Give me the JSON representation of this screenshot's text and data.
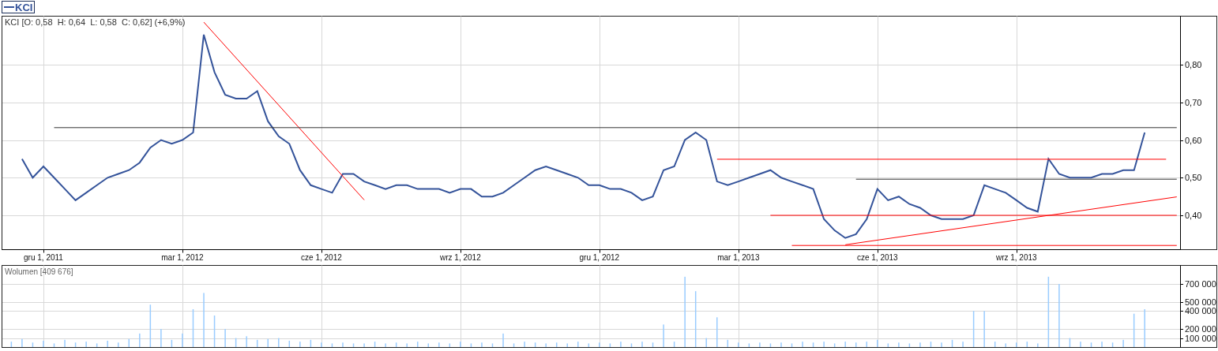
{
  "price_panel": {
    "header": "KCI [O: 0,58  H: 0,64  L: 0,58  C: 0,62] (+6,9%)",
    "chart_data": {
      "type": "line",
      "grid": true,
      "ylim": [
        0.31,
        0.93
      ],
      "categories": [
        null,
        null,
        null,
        "gru 1, 2011",
        null,
        null,
        null,
        null,
        null,
        null,
        null,
        null,
        null,
        null,
        null,
        null,
        "mar 1, 2012",
        null,
        null,
        null,
        null,
        null,
        null,
        null,
        null,
        null,
        null,
        null,
        null,
        "cze 1, 2012",
        null,
        null,
        null,
        null,
        null,
        null,
        null,
        null,
        null,
        null,
        null,
        null,
        "wrz 1, 2012",
        null,
        null,
        null,
        null,
        null,
        null,
        null,
        null,
        null,
        null,
        null,
        null,
        "gru 1, 2012",
        null,
        null,
        null,
        null,
        null,
        null,
        null,
        null,
        null,
        null,
        null,
        null,
        "mar 1, 2013",
        null,
        null,
        null,
        null,
        null,
        null,
        null,
        null,
        null,
        null,
        null,
        null,
        "cze 1, 2013",
        null,
        null,
        null,
        null,
        null,
        null,
        null,
        null,
        null,
        null,
        null,
        null,
        "wrz 1, 2013",
        null,
        null,
        null,
        null,
        null,
        null,
        null,
        null,
        null,
        null,
        null,
        null,
        null,
        null,
        null
      ],
      "yticks": [
        {
          "value": 0.4,
          "label": "0,40"
        },
        {
          "value": 0.5,
          "label": "0,50"
        },
        {
          "value": 0.6,
          "label": "0,60"
        },
        {
          "value": 0.7,
          "label": "0,70"
        },
        {
          "value": 0.8,
          "label": "0,80"
        }
      ],
      "series": [
        {
          "name": "KCI",
          "color": "#34539a",
          "values": [
            null,
            0.55,
            0.5,
            0.53,
            0.5,
            0.47,
            0.44,
            0.46,
            0.48,
            0.5,
            0.51,
            0.52,
            0.54,
            0.58,
            0.6,
            0.59,
            0.6,
            0.62,
            0.88,
            0.78,
            0.72,
            0.71,
            0.71,
            0.73,
            0.65,
            0.61,
            0.59,
            0.52,
            0.48,
            0.47,
            0.46,
            0.51,
            0.51,
            0.49,
            0.48,
            0.47,
            0.48,
            0.48,
            0.47,
            0.47,
            0.47,
            0.46,
            0.47,
            0.47,
            0.45,
            0.45,
            0.46,
            0.48,
            0.5,
            0.52,
            0.53,
            0.52,
            0.51,
            0.5,
            0.48,
            0.48,
            0.47,
            0.47,
            0.46,
            0.44,
            0.45,
            0.52,
            0.53,
            0.6,
            0.62,
            0.6,
            0.49,
            0.48,
            0.49,
            0.5,
            0.51,
            0.52,
            0.5,
            0.49,
            0.48,
            0.47,
            0.39,
            0.36,
            0.34,
            0.35,
            0.39,
            0.47,
            0.44,
            0.45,
            0.43,
            0.42,
            0.4,
            0.39,
            0.39,
            0.39,
            0.4,
            0.48,
            0.47,
            0.46,
            0.44,
            0.42,
            0.41,
            0.55,
            0.51,
            0.5,
            0.5,
            0.5,
            0.51,
            0.51,
            0.52,
            0.52,
            0.62,
            null,
            null,
            null
          ]
        },
        {
          "color": "#ff0000",
          "values": [
            null,
            null,
            null,
            null,
            null,
            null,
            null,
            null,
            null,
            null,
            null,
            null,
            null,
            null,
            null,
            null,
            null,
            null,
            0.913,
            null,
            null,
            null,
            null,
            null,
            null,
            null,
            null,
            null,
            null,
            null,
            null,
            null,
            null,
            0.441,
            null,
            null,
            null,
            null,
            null,
            null,
            null,
            null,
            null,
            null,
            null,
            null,
            null,
            null,
            null,
            null,
            null,
            null,
            null,
            null,
            null,
            null,
            null,
            null,
            null,
            null,
            null,
            null,
            null,
            null,
            null,
            null,
            null,
            null,
            null,
            null,
            null,
            null,
            null,
            null,
            null,
            null,
            null,
            null,
            null,
            null,
            null,
            null,
            null,
            null,
            null,
            null,
            null,
            null,
            null,
            null,
            null,
            null,
            null,
            null,
            null,
            null,
            null,
            null,
            null,
            null,
            null,
            null,
            null,
            null,
            null,
            null,
            null,
            null,
            null,
            null
          ]
        },
        {
          "color": "#333333",
          "values": [
            null,
            null,
            null,
            null,
            0.633,
            null,
            null,
            null,
            null,
            null,
            null,
            null,
            null,
            null,
            null,
            null,
            null,
            null,
            null,
            null,
            null,
            null,
            null,
            null,
            null,
            null,
            null,
            null,
            null,
            null,
            null,
            null,
            null,
            null,
            null,
            null,
            null,
            null,
            null,
            null,
            null,
            null,
            null,
            null,
            null,
            null,
            null,
            null,
            null,
            null,
            null,
            null,
            null,
            null,
            null,
            null,
            null,
            null,
            null,
            null,
            null,
            null,
            null,
            null,
            null,
            null,
            null,
            null,
            null,
            null,
            null,
            null,
            null,
            null,
            null,
            null,
            null,
            null,
            null,
            null,
            null,
            null,
            null,
            null,
            null,
            null,
            null,
            null,
            null,
            null,
            null,
            null,
            null,
            null,
            null,
            null,
            null,
            null,
            null,
            null,
            null,
            null,
            null,
            null,
            null,
            null,
            null,
            null,
            null,
            0.633
          ]
        },
        {
          "color": "#ff0000",
          "values": [
            null,
            null,
            null,
            null,
            null,
            null,
            null,
            null,
            null,
            null,
            null,
            null,
            null,
            null,
            null,
            null,
            null,
            null,
            null,
            null,
            null,
            null,
            null,
            null,
            null,
            null,
            null,
            null,
            null,
            null,
            null,
            null,
            null,
            null,
            null,
            null,
            null,
            null,
            null,
            null,
            null,
            null,
            null,
            null,
            null,
            null,
            null,
            null,
            null,
            null,
            null,
            null,
            null,
            null,
            null,
            null,
            null,
            null,
            null,
            null,
            null,
            null,
            null,
            null,
            null,
            null,
            0.549,
            null,
            null,
            null,
            null,
            null,
            null,
            null,
            null,
            null,
            null,
            null,
            null,
            null,
            null,
            null,
            null,
            null,
            null,
            null,
            null,
            null,
            null,
            null,
            null,
            null,
            null,
            null,
            null,
            null,
            null,
            null,
            null,
            null,
            null,
            null,
            null,
            null,
            null,
            null,
            null,
            null,
            0.549,
            null
          ]
        },
        {
          "color": "#333333",
          "values": [
            null,
            null,
            null,
            null,
            null,
            null,
            null,
            null,
            null,
            null,
            null,
            null,
            null,
            null,
            null,
            null,
            null,
            null,
            null,
            null,
            null,
            null,
            null,
            null,
            null,
            null,
            null,
            null,
            null,
            null,
            null,
            null,
            null,
            null,
            null,
            null,
            null,
            null,
            null,
            null,
            null,
            null,
            null,
            null,
            null,
            null,
            null,
            null,
            null,
            null,
            null,
            null,
            null,
            null,
            null,
            null,
            null,
            null,
            null,
            null,
            null,
            null,
            null,
            null,
            null,
            null,
            null,
            null,
            null,
            null,
            null,
            null,
            null,
            null,
            null,
            null,
            null,
            null,
            null,
            0.496,
            null,
            null,
            null,
            null,
            null,
            null,
            null,
            null,
            null,
            null,
            null,
            null,
            null,
            null,
            null,
            null,
            null,
            null,
            null,
            null,
            null,
            null,
            null,
            null,
            null,
            null,
            null,
            null,
            null,
            0.496
          ]
        },
        {
          "color": "#ff0000",
          "values": [
            null,
            null,
            null,
            null,
            null,
            null,
            null,
            null,
            null,
            null,
            null,
            null,
            null,
            null,
            null,
            null,
            null,
            null,
            null,
            null,
            null,
            null,
            null,
            null,
            null,
            null,
            null,
            null,
            null,
            null,
            null,
            null,
            null,
            null,
            null,
            null,
            null,
            null,
            null,
            null,
            null,
            null,
            null,
            null,
            null,
            null,
            null,
            null,
            null,
            null,
            null,
            null,
            null,
            null,
            null,
            null,
            null,
            null,
            null,
            null,
            null,
            null,
            null,
            null,
            null,
            null,
            null,
            null,
            null,
            null,
            null,
            0.4,
            null,
            null,
            null,
            null,
            null,
            null,
            null,
            null,
            null,
            null,
            null,
            null,
            null,
            null,
            null,
            null,
            null,
            null,
            null,
            null,
            null,
            null,
            null,
            null,
            null,
            null,
            null,
            null,
            null,
            null,
            null,
            null,
            null,
            null,
            null,
            null,
            null,
            0.4
          ]
        },
        {
          "color": "#ff0000",
          "values": [
            null,
            null,
            null,
            null,
            null,
            null,
            null,
            null,
            null,
            null,
            null,
            null,
            null,
            null,
            null,
            null,
            null,
            null,
            null,
            null,
            null,
            null,
            null,
            null,
            null,
            null,
            null,
            null,
            null,
            null,
            null,
            null,
            null,
            null,
            null,
            null,
            null,
            null,
            null,
            null,
            null,
            null,
            null,
            null,
            null,
            null,
            null,
            null,
            null,
            null,
            null,
            null,
            null,
            null,
            null,
            null,
            null,
            null,
            null,
            null,
            null,
            null,
            null,
            null,
            null,
            null,
            null,
            null,
            null,
            null,
            null,
            null,
            null,
            null,
            null,
            null,
            null,
            null,
            0.322,
            null,
            null,
            null,
            null,
            null,
            null,
            null,
            null,
            null,
            null,
            null,
            null,
            null,
            null,
            null,
            null,
            null,
            null,
            null,
            null,
            null,
            null,
            null,
            null,
            null,
            null,
            null,
            null,
            null,
            null,
            0.449
          ]
        },
        {
          "color": "#ff0000",
          "values": [
            null,
            null,
            null,
            null,
            null,
            null,
            null,
            null,
            null,
            null,
            null,
            null,
            null,
            null,
            null,
            null,
            null,
            null,
            null,
            null,
            null,
            null,
            null,
            null,
            null,
            null,
            null,
            null,
            null,
            null,
            null,
            null,
            null,
            null,
            null,
            null,
            null,
            null,
            null,
            null,
            null,
            null,
            null,
            null,
            null,
            null,
            null,
            null,
            null,
            null,
            null,
            null,
            null,
            null,
            null,
            null,
            null,
            null,
            null,
            null,
            null,
            null,
            null,
            null,
            null,
            null,
            null,
            null,
            null,
            null,
            null,
            null,
            null,
            0.32,
            null,
            null,
            null,
            null,
            null,
            null,
            null,
            null,
            null,
            null,
            null,
            null,
            null,
            null,
            null,
            null,
            null,
            null,
            null,
            null,
            null,
            null,
            null,
            null,
            null,
            null,
            null,
            null,
            null,
            null,
            null,
            null,
            null,
            null,
            null,
            0.32
          ]
        }
      ]
    }
  },
  "volume_panel": {
    "header": "Wolumen [409 676]",
    "chart_data": {
      "type": "bar",
      "grid": true,
      "ylim": [
        0,
        910000
      ],
      "categories": [
        null,
        null,
        null,
        null,
        null,
        null,
        null,
        null,
        null,
        null,
        null,
        null,
        null,
        null,
        null,
        null,
        null,
        null,
        null,
        null,
        null,
        null,
        null,
        null,
        null,
        null,
        null,
        null,
        null,
        null,
        null,
        null,
        null,
        null,
        null,
        null,
        null,
        null,
        null,
        null,
        null,
        null,
        null,
        null,
        null,
        null,
        null,
        null,
        null,
        null,
        null,
        null,
        null,
        null,
        null,
        null,
        null,
        null,
        null,
        null,
        null,
        null,
        null,
        null,
        null,
        null,
        null,
        null,
        null,
        null,
        null,
        null,
        null,
        null,
        null,
        null,
        null,
        null,
        null,
        null,
        null,
        null,
        null,
        null,
        null,
        null,
        null,
        null,
        null,
        null,
        null,
        null,
        null,
        null,
        null,
        null,
        null,
        null,
        null,
        null,
        null,
        null,
        null,
        null,
        null,
        null,
        null,
        null,
        null,
        null
      ],
      "yticks": [
        {
          "value": 100000,
          "label": "100 000"
        },
        {
          "value": 200000,
          "label": "200 000"
        },
        {
          "value": 400000,
          "label": "400 000"
        },
        {
          "value": 500000,
          "label": "500 000"
        },
        {
          "value": 700000,
          "label": "700 000"
        }
      ],
      "series": [
        {
          "color": "#99ccff",
          "values": [
            60000,
            90000,
            50000,
            70000,
            40000,
            80000,
            50000,
            60000,
            40000,
            70000,
            50000,
            90000,
            150000,
            470000,
            200000,
            80000,
            150000,
            420000,
            600000,
            350000,
            200000,
            100000,
            120000,
            80000,
            90000,
            100000,
            70000,
            60000,
            80000,
            50000,
            40000,
            50000,
            40000,
            40000,
            60000,
            40000,
            50000,
            40000,
            60000,
            40000,
            50000,
            40000,
            60000,
            40000,
            50000,
            40000,
            150000,
            40000,
            60000,
            50000,
            40000,
            50000,
            40000,
            60000,
            40000,
            50000,
            40000,
            60000,
            40000,
            60000,
            50000,
            250000,
            60000,
            780000,
            620000,
            100000,
            330000,
            80000,
            50000,
            40000,
            50000,
            40000,
            50000,
            40000,
            60000,
            50000,
            60000,
            40000,
            60000,
            50000,
            60000,
            80000,
            40000,
            50000,
            40000,
            50000,
            60000,
            50000,
            80000,
            60000,
            400000,
            400000,
            60000,
            40000,
            50000,
            60000,
            40000,
            780000,
            700000,
            100000,
            60000,
            50000,
            60000,
            50000,
            80000,
            370000,
            420000,
            null,
            null,
            null
          ]
        }
      ]
    }
  }
}
